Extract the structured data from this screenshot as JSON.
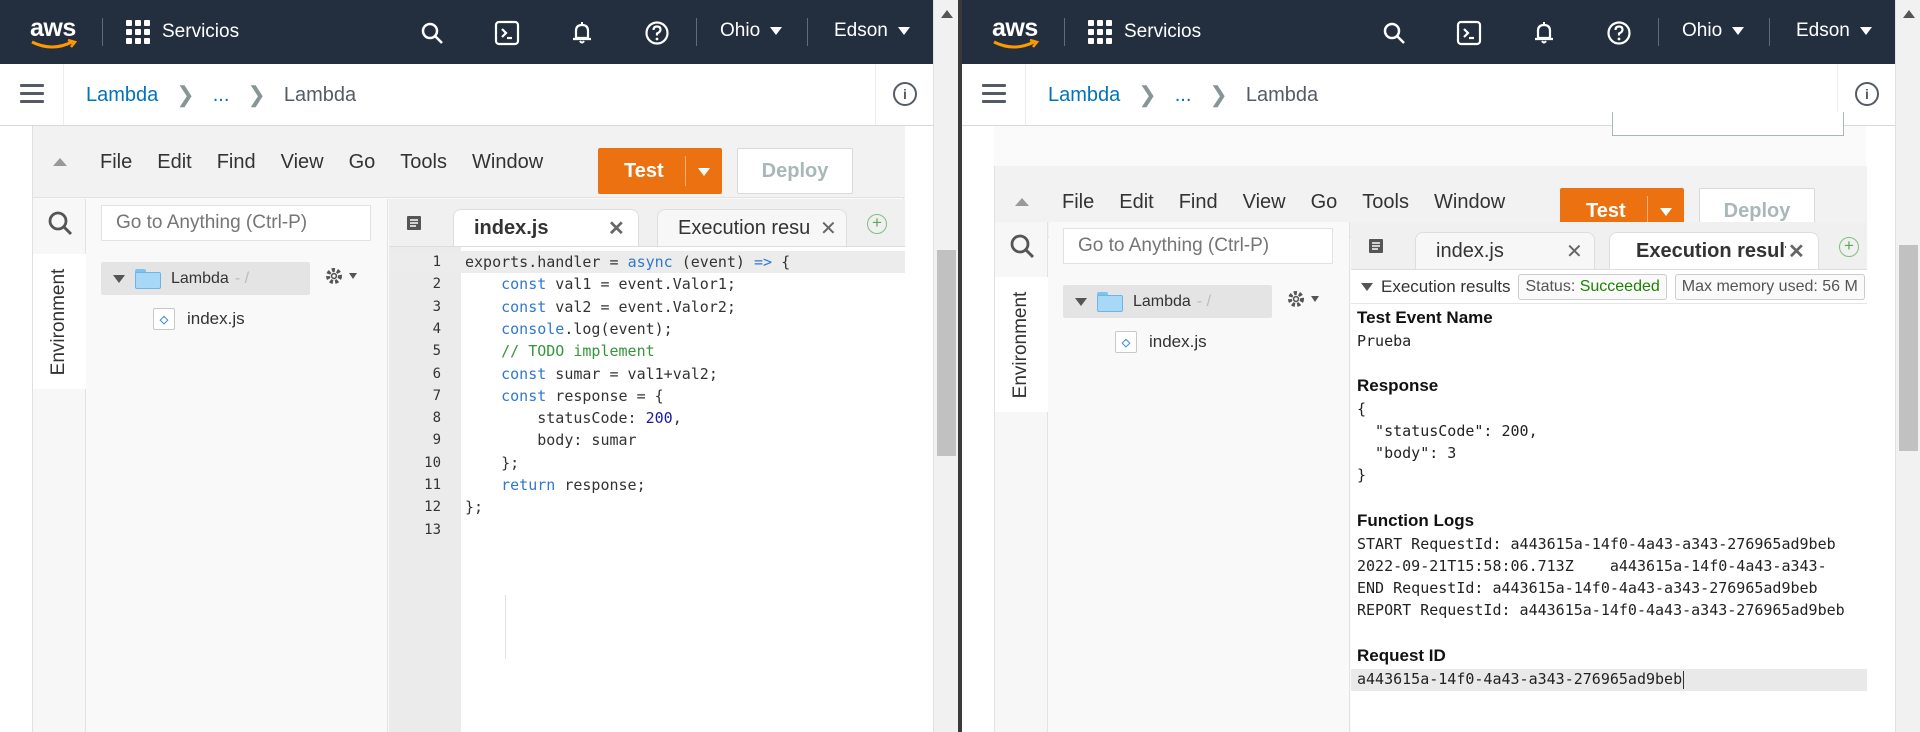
{
  "nav": {
    "logo": "aws",
    "services": "Servicios",
    "region": "Ohio",
    "user": "Edson",
    "icons": [
      "search-icon",
      "cloudshell-icon",
      "bell-icon",
      "help-icon"
    ]
  },
  "breadcrumb": {
    "root": "Lambda",
    "ellipsis": "...",
    "current": "Lambda"
  },
  "menus": [
    "File",
    "Edit",
    "Find",
    "View",
    "Go",
    "Tools",
    "Window"
  ],
  "buttons": {
    "test": "Test",
    "deploy": "Deploy"
  },
  "search_placeholder": "Go to Anything (Ctrl-P)",
  "env_tab": "Environment",
  "tree": {
    "root": "Lambda",
    "root_suffix": "- /",
    "file": "index.js"
  },
  "tabs": {
    "index": "index.js",
    "exec_left": "Execution resu",
    "exec_right": "Execution results"
  },
  "code": {
    "lines": [
      {
        "n": "1",
        "parts": [
          [
            "",
            "exports.handler = "
          ],
          [
            "kw",
            "async"
          ],
          [
            "",
            " (event) "
          ],
          [
            "kw",
            "=>"
          ],
          [
            "",
            " {"
          ]
        ]
      },
      {
        "n": "2",
        "parts": [
          [
            "",
            "    "
          ],
          [
            "kw",
            "const"
          ],
          [
            "",
            " val1 = event.Valor1;"
          ]
        ]
      },
      {
        "n": "3",
        "parts": [
          [
            "",
            "    "
          ],
          [
            "kw",
            "const"
          ],
          [
            "",
            " val2 = event.Valor2;"
          ]
        ]
      },
      {
        "n": "4",
        "parts": [
          [
            "",
            "    "
          ],
          [
            "kw",
            "console"
          ],
          [
            "",
            ".log(event);"
          ]
        ]
      },
      {
        "n": "5",
        "parts": [
          [
            "",
            "    "
          ],
          [
            "cm",
            "// TODO implement"
          ]
        ]
      },
      {
        "n": "6",
        "parts": [
          [
            "",
            "    "
          ],
          [
            "kw",
            "const"
          ],
          [
            "",
            " sumar = val1+val2;"
          ]
        ]
      },
      {
        "n": "7",
        "parts": [
          [
            "",
            "    "
          ],
          [
            "kw",
            "const"
          ],
          [
            "",
            " response = {"
          ]
        ]
      },
      {
        "n": "8",
        "parts": [
          [
            "",
            "        statusCode: "
          ],
          [
            "numc",
            "200"
          ],
          [
            "",
            ","
          ]
        ]
      },
      {
        "n": "9",
        "parts": [
          [
            "",
            "        body: sumar"
          ]
        ]
      },
      {
        "n": "10",
        "parts": [
          [
            "",
            "    };"
          ]
        ]
      },
      {
        "n": "11",
        "parts": [
          [
            "",
            "    "
          ],
          [
            "kw",
            "return"
          ],
          [
            "",
            " response;"
          ]
        ]
      },
      {
        "n": "12",
        "parts": [
          [
            "",
            "};"
          ]
        ]
      },
      {
        "n": "13",
        "parts": []
      }
    ]
  },
  "results": {
    "header": "Execution results",
    "status_label": "Status: ",
    "status_value": "Succeeded",
    "memory_label": "Max memory used: 56 M",
    "test_event_h": "Test Event Name",
    "test_event": "Prueba",
    "response_h": "Response",
    "response_lines": [
      "{",
      "  \"statusCode\": 200,",
      "  \"body\": 3",
      "}"
    ],
    "logs_h": "Function Logs",
    "log_lines": [
      "START RequestId: a443615a-14f0-4a43-a343-276965ad9beb",
      "2022-09-21T15:58:06.713Z    a443615a-14f0-4a43-a343-",
      "END RequestId: a443615a-14f0-4a43-a343-276965ad9beb",
      "REPORT RequestId: a443615a-14f0-4a43-a343-276965ad9beb"
    ],
    "reqid_h": "Request ID",
    "reqid": "a443615a-14f0-4a43-a343-276965ad9beb"
  }
}
